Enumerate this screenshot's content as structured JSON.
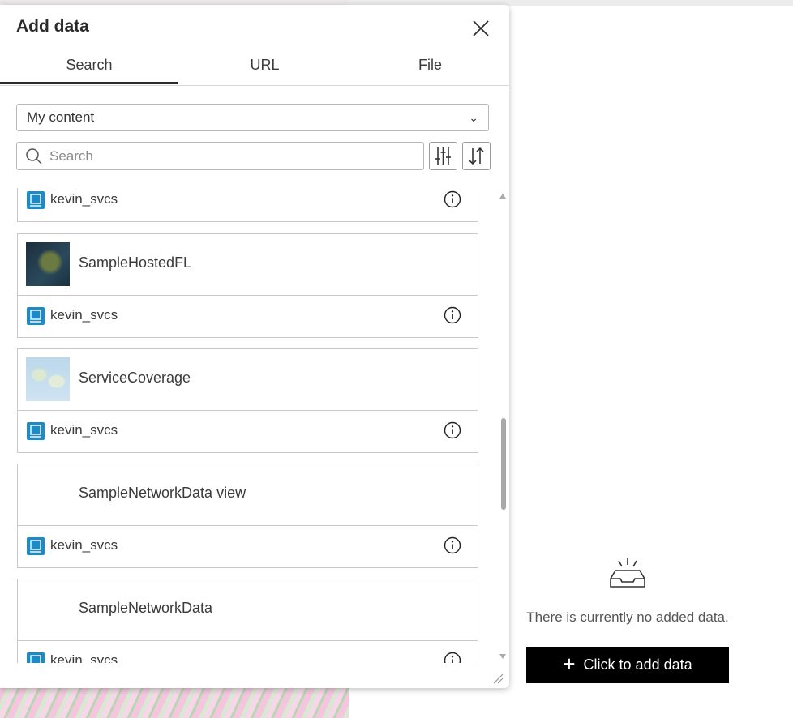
{
  "dialog": {
    "title": "Add data",
    "tabs": [
      "Search",
      "URL",
      "File"
    ],
    "active_tab": "Search",
    "source_select": "My content",
    "search_placeholder": "Search"
  },
  "items": [
    {
      "title": "",
      "owner": "kevin_svcs",
      "thumbnail": "none",
      "partial": true
    },
    {
      "title": "SampleHostedFL",
      "owner": "kevin_svcs",
      "thumbnail": "satellite"
    },
    {
      "title": "ServiceCoverage",
      "owner": "kevin_svcs",
      "thumbnail": "world-map"
    },
    {
      "title": "SampleNetworkData view",
      "owner": "kevin_svcs",
      "thumbnail": "none"
    },
    {
      "title": "SampleNetworkData",
      "owner": "kevin_svcs",
      "thumbnail": "none"
    }
  ],
  "empty_state": {
    "message": "There is currently no added data.",
    "button_label": "Click to add data"
  },
  "colors": {
    "accent": "#1a8ac9",
    "button_bg": "#000000"
  }
}
